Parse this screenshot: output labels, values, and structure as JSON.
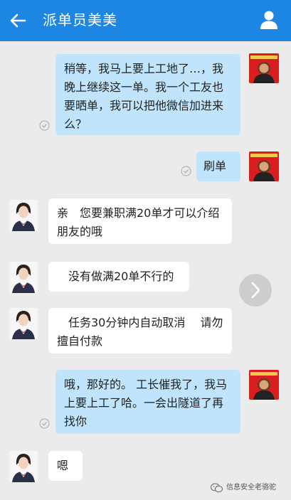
{
  "header": {
    "title": "派单员美美",
    "back_icon": "arrow-left-icon",
    "profile_icon": "user-icon"
  },
  "messages": [
    {
      "sender": "me",
      "text": "稍等，我马上要上工地了…，我晚上继续这一单。我一个工友也要晒单，我可以把他微信加进来么？",
      "status_icon": "check-circle-icon"
    },
    {
      "sender": "me",
      "text": "刷单",
      "status_icon": "check-circle-icon"
    },
    {
      "sender": "agent",
      "text": "亲　您要兼职满20单才可以介绍朋友的哦"
    },
    {
      "sender": "agent",
      "text": "　没有做满20单不行的"
    },
    {
      "sender": "agent",
      "text": "　任务30分钟内自动取消　 请勿擅自付款"
    },
    {
      "sender": "me",
      "text": "哦，那好的。 工长催我了，我马上要上工了哈。一会出隧道了再找你",
      "status_icon": "check-circle-icon"
    },
    {
      "sender": "agent",
      "text": "嗯"
    }
  ],
  "next_button_icon": "chevron-right-icon",
  "watermark": {
    "text": "信息安全老骆驼",
    "icon": "wechat-icon"
  },
  "colors": {
    "header_bg": "#1d86e2",
    "chat_bg": "#ebebeb",
    "my_bubble": "#bfe4fb",
    "agent_bubble": "#ffffff"
  }
}
